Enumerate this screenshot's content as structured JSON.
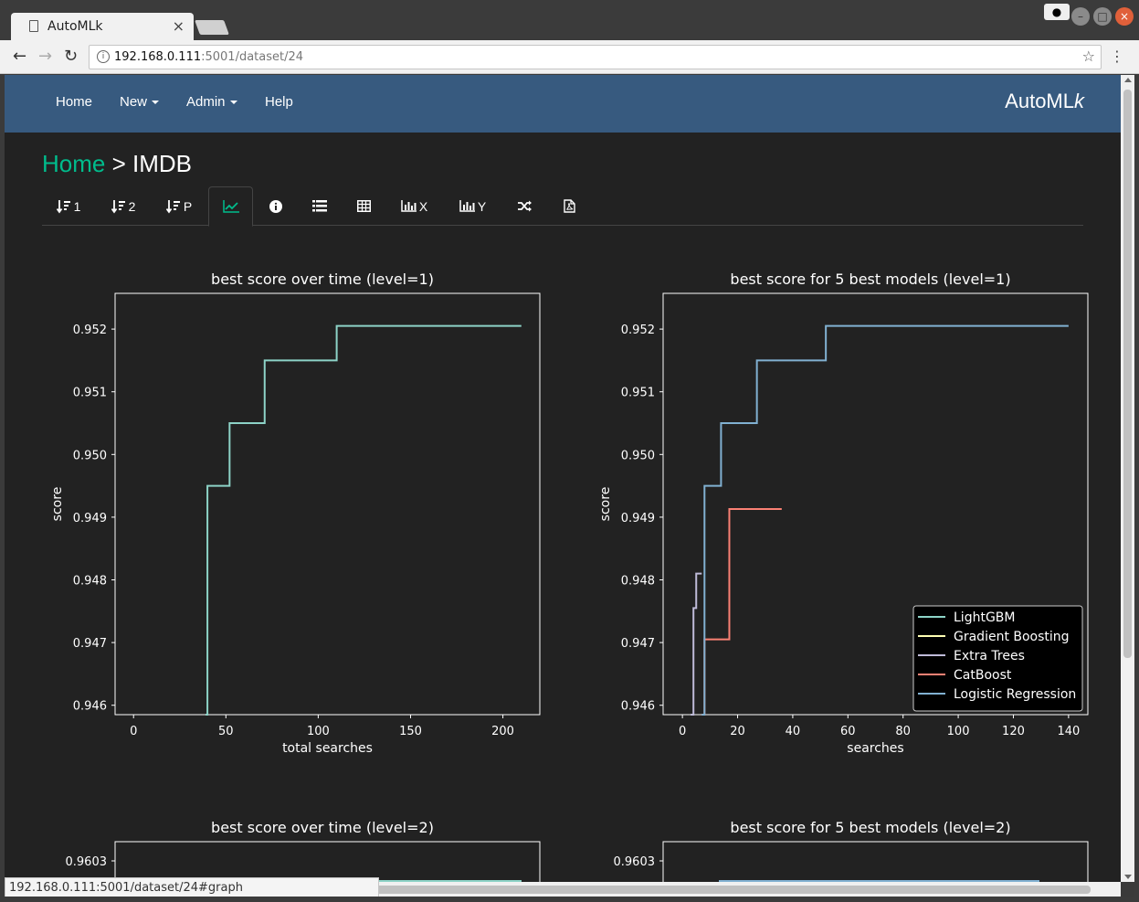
{
  "browser": {
    "tab_title": "AutoMLk",
    "url_host": "192.168.0.111",
    "url_path": ":5001/dataset/24",
    "status_url": "192.168.0.111:5001/dataset/24#graph",
    "icons": [
      "back-icon",
      "forward-icon",
      "reload-icon",
      "info-icon",
      "star-icon",
      "menu-icon"
    ]
  },
  "navbar": {
    "items": [
      {
        "label": "Home"
      },
      {
        "label": "New"
      },
      {
        "label": "Admin"
      },
      {
        "label": "Help"
      }
    ],
    "brand_main": "AutoML",
    "brand_italic": "k"
  },
  "breadcrumb": {
    "home": "Home",
    "sep": " > ",
    "current": "IMDB"
  },
  "tabs": [
    {
      "icon": "sort-icon",
      "label": "1"
    },
    {
      "icon": "sort-icon",
      "label": "2"
    },
    {
      "icon": "sort-icon",
      "label": "P"
    },
    {
      "icon": "line-chart-icon",
      "label": "",
      "active": true
    },
    {
      "icon": "info-icon",
      "label": ""
    },
    {
      "icon": "list-icon",
      "label": ""
    },
    {
      "icon": "table-icon",
      "label": ""
    },
    {
      "icon": "bar-chart-icon",
      "label": "X"
    },
    {
      "icon": "bar-chart-icon",
      "label": "Y"
    },
    {
      "icon": "random-icon",
      "label": ""
    },
    {
      "icon": "pdf-icon",
      "label": ""
    }
  ],
  "colors": {
    "accent": "#00bc8c",
    "navbar": "#375a7f",
    "page_bg": "#222222",
    "LightGBM": "#8dd3c7",
    "Gradient Boosting": "#feffb3",
    "Extra Trees": "#bfbbd9",
    "CatBoost": "#fa8174",
    "Logistic Regression": "#81b1d2"
  },
  "chart_data": [
    {
      "type": "line",
      "title": "best score over time (level=1)",
      "xlabel": "total searches",
      "ylabel": "score",
      "xlim": [
        -10,
        220
      ],
      "ylim": [
        0.94585,
        0.95257
      ],
      "xticks": [
        0,
        50,
        100,
        150,
        200
      ],
      "yticks": [
        0.946,
        0.947,
        0.948,
        0.949,
        0.95,
        0.951,
        0.952
      ],
      "ytick_labels": [
        "0.946",
        "0.947",
        "0.948",
        "0.949",
        "0.950",
        "0.951",
        "0.952"
      ],
      "series": [
        {
          "color": "#8dd3c7",
          "step": true,
          "x": [
            39,
            40,
            52,
            71,
            110,
            210
          ],
          "y": [
            0.94585,
            0.9495,
            0.9505,
            0.9515,
            0.95205,
            0.95205
          ]
        }
      ]
    },
    {
      "type": "line",
      "title": "best score for 5 best models (level=1)",
      "xlabel": "searches",
      "ylabel": "score",
      "xlim": [
        -7,
        147
      ],
      "ylim": [
        0.94585,
        0.95257
      ],
      "xticks": [
        0,
        20,
        40,
        60,
        80,
        100,
        120,
        140
      ],
      "yticks": [
        0.946,
        0.947,
        0.948,
        0.949,
        0.95,
        0.951,
        0.952
      ],
      "ytick_labels": [
        "0.946",
        "0.947",
        "0.948",
        "0.949",
        "0.950",
        "0.951",
        "0.952"
      ],
      "legend": "lower-right",
      "series": [
        {
          "name": "LightGBM",
          "color": "#8dd3c7",
          "step": true,
          "x": [],
          "y": []
        },
        {
          "name": "Gradient Boosting",
          "color": "#feffb3",
          "step": true,
          "x": [],
          "y": []
        },
        {
          "name": "Extra Trees",
          "color": "#bfbbd9",
          "step": true,
          "x": [
            3,
            4,
            5,
            7
          ],
          "y": [
            0.94585,
            0.94755,
            0.9481,
            0.9481
          ]
        },
        {
          "name": "CatBoost",
          "color": "#fa8174",
          "step": true,
          "x": [
            7,
            8,
            17,
            36
          ],
          "y": [
            0.94585,
            0.94705,
            0.94913,
            0.94913
          ]
        },
        {
          "name": "Logistic Regression",
          "color": "#81b1d2",
          "step": true,
          "x": [
            7,
            8,
            14,
            27,
            52,
            140
          ],
          "y": [
            0.94585,
            0.9495,
            0.9505,
            0.9515,
            0.95205,
            0.95205
          ]
        }
      ]
    },
    {
      "type": "line",
      "title": "best score over time (level=2)",
      "xlabel": "",
      "ylabel": "",
      "ytick_labels": [
        "0.9603"
      ],
      "series": [
        {
          "color": "#8dd3c7",
          "x": [],
          "y": []
        }
      ]
    },
    {
      "type": "line",
      "title": "best score for 5 best models (level=2)",
      "xlabel": "",
      "ylabel": "",
      "ytick_labels": [
        "0.9603"
      ],
      "series": [
        {
          "color": "#81b1d2",
          "x": [],
          "y": []
        }
      ]
    }
  ]
}
